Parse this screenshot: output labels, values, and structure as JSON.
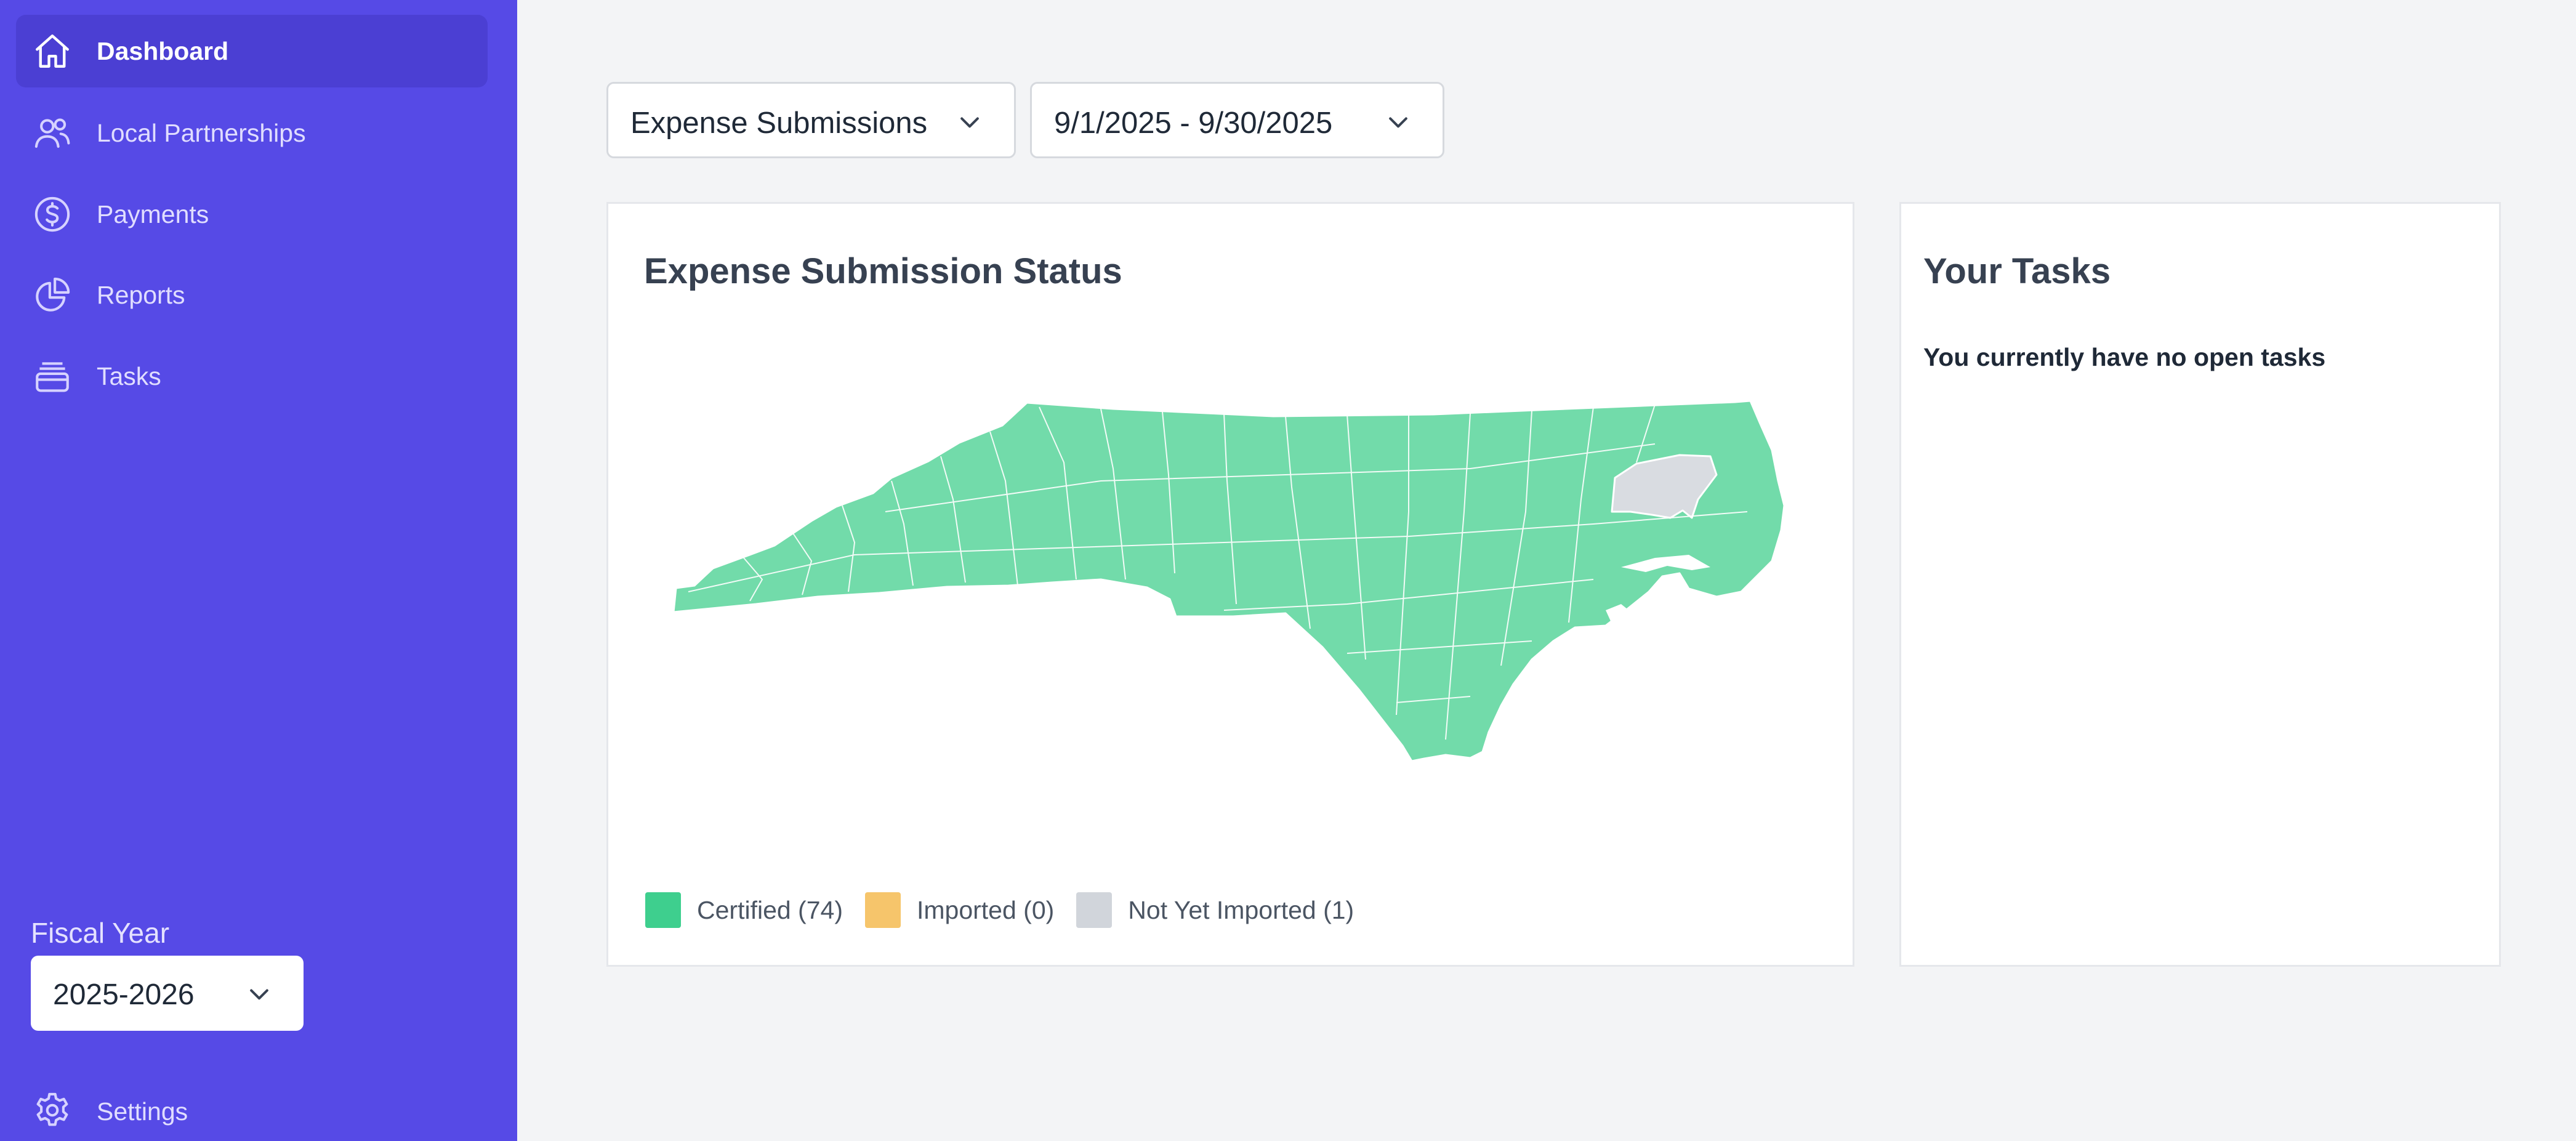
{
  "sidebar": {
    "items": [
      {
        "label": "Dashboard",
        "icon": "home-icon",
        "active": true
      },
      {
        "label": "Local Partnerships",
        "icon": "users-icon",
        "active": false
      },
      {
        "label": "Payments",
        "icon": "dollar-circle-icon",
        "active": false
      },
      {
        "label": "Reports",
        "icon": "pie-chart-icon",
        "active": false
      },
      {
        "label": "Tasks",
        "icon": "stack-icon",
        "active": false
      }
    ],
    "fiscal_year_label": "Fiscal Year",
    "fiscal_year_value": "2025-2026",
    "settings_label": "Settings",
    "settings_icon": "gear-icon"
  },
  "filters": {
    "type_value": "Expense Submissions",
    "date_range_value": "9/1/2025 - 9/30/2025"
  },
  "status_card": {
    "title": "Expense Submission Status",
    "legend": [
      {
        "label": "Certified (74)",
        "color": "#3ecf8e"
      },
      {
        "label": "Imported (0)",
        "color": "#f6c56b"
      },
      {
        "label": "Not Yet Imported (1)",
        "color": "#d1d5db"
      }
    ],
    "map_colors": {
      "certified": "#72dbaa",
      "not_imported": "#d9dce1",
      "border": "#ffffff"
    }
  },
  "tasks_card": {
    "title": "Your Tasks",
    "empty_message": "You currently have no open tasks"
  },
  "colors": {
    "sidebar": "#564ae6",
    "sidebar_active": "#4b3fd3",
    "page_bg": "#f3f4f6"
  }
}
